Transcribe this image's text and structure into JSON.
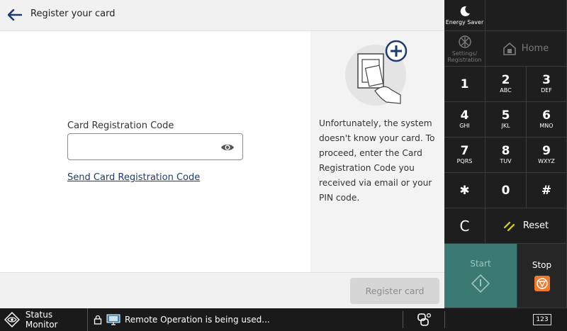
{
  "header": {
    "title": "Register your card"
  },
  "form": {
    "field_label": "Card Registration Code",
    "field_value": "",
    "field_placeholder": "",
    "send_link": "Send Card Registration Code"
  },
  "info": {
    "text": "Unfortunately, the system doesn't know your card. To proceed, enter the Card Registration Code you received via email or your PIN code."
  },
  "footer": {
    "register_label": "Register card"
  },
  "keypad": {
    "energy_saver": "Energy Saver",
    "settings": "Settings/ Registration",
    "home": "Home",
    "keys": [
      {
        "num": "1",
        "sub": ""
      },
      {
        "num": "2",
        "sub": "ABC"
      },
      {
        "num": "3",
        "sub": "DEF"
      },
      {
        "num": "4",
        "sub": "GHI"
      },
      {
        "num": "5",
        "sub": "JKL"
      },
      {
        "num": "6",
        "sub": "MNO"
      },
      {
        "num": "7",
        "sub": "PQRS"
      },
      {
        "num": "8",
        "sub": "TUV"
      },
      {
        "num": "9",
        "sub": "WXYZ"
      },
      {
        "num": "✱",
        "sub": ""
      },
      {
        "num": "0",
        "sub": ""
      },
      {
        "num": "#",
        "sub": ""
      }
    ],
    "clear": "C",
    "reset": "Reset",
    "start": "Start",
    "stop": "Stop"
  },
  "statusbar": {
    "status_monitor": "Status Monitor",
    "remote_text": "Remote Operation is being used...",
    "kbd_label": "123"
  },
  "colors": {
    "accent": "#1d3b6e",
    "start_bg": "#3b7a73",
    "stop_icon": "#f07a2a",
    "reset_icon": "#e6d200",
    "plus_badge": "#1d3b6e"
  },
  "icons": {
    "back": "arrow-left-icon",
    "eye": "eye-icon",
    "energy": "moon-icon",
    "settings": "settings-icon",
    "home": "home-icon",
    "start": "start-diamond-icon",
    "stop": "stop-icon",
    "reset": "reset-slash-icon",
    "status": "eye-diamond-icon",
    "lock": "lock-icon",
    "monitor": "monitor-icon",
    "link": "link-icon",
    "keyboard": "keyboard-123-icon"
  }
}
